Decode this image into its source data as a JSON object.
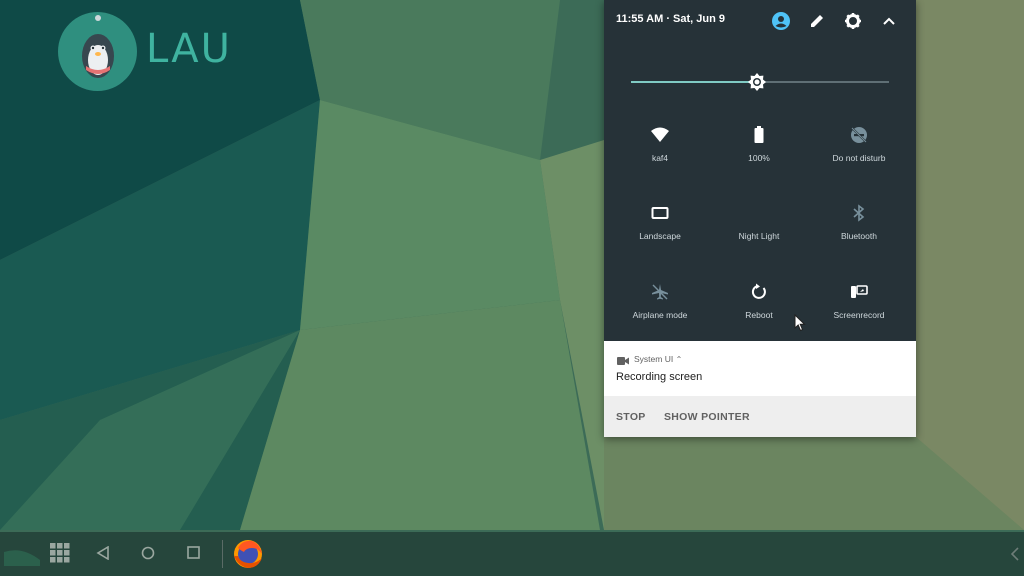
{
  "brand": {
    "logo_text": "LAU"
  },
  "quick_settings": {
    "header": {
      "time_date": "11:55 AM · Sat, Jun 9"
    },
    "brightness_level": 0.49,
    "tiles": [
      {
        "label": "kaf4",
        "icon": "wifi-icon"
      },
      {
        "label": "100%",
        "icon": "battery-icon"
      },
      {
        "label": "Do not disturb",
        "icon": "do-not-disturb-icon"
      },
      {
        "label": "Landscape",
        "icon": "landscape-icon"
      },
      {
        "label": "Night Light",
        "icon": "night-light-icon"
      },
      {
        "label": "Bluetooth",
        "icon": "bluetooth-icon"
      },
      {
        "label": "Airplane mode",
        "icon": "airplane-icon"
      },
      {
        "label": "Reboot",
        "icon": "reboot-icon"
      },
      {
        "label": "Screenrecord",
        "icon": "screenrecord-icon"
      }
    ]
  },
  "notification": {
    "app_name": "System UI",
    "title": "Recording screen",
    "actions": {
      "stop": "STOP",
      "show_pointer": "SHOW POINTER"
    }
  },
  "colors": {
    "panel_bg": "#263238",
    "accent": "#80cbc4",
    "brand": "#3fb3a0"
  }
}
